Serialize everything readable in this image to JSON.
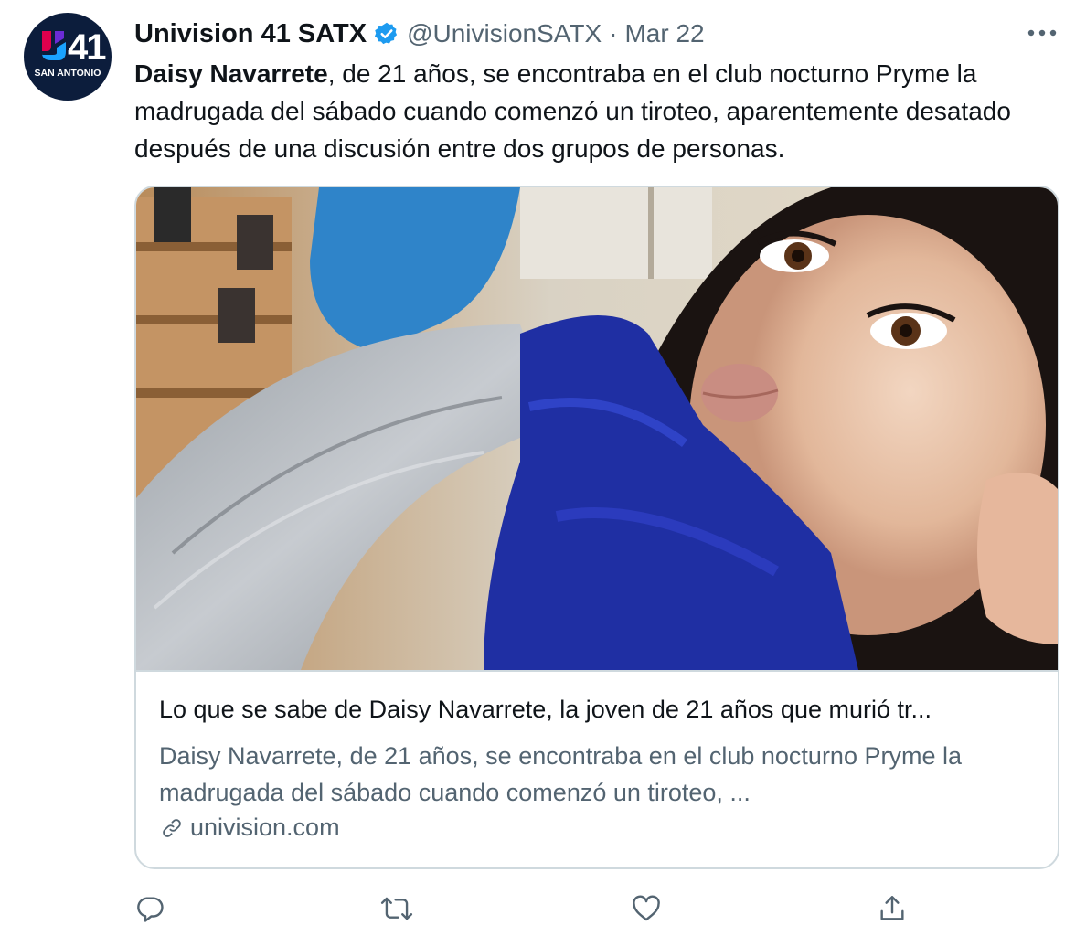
{
  "account": {
    "display_name": "Univision 41 SATX",
    "handle": "@UnivisionSATX",
    "separator": "·",
    "date": "Mar 22",
    "avatar_number": "41",
    "avatar_city": "SAN ANTONIO"
  },
  "tweet": {
    "name_highlight": "Daisy Navarrete",
    "text_rest": ", de 21 años, se encontraba en el club nocturno Pryme la madrugada del sábado cuando comenzó un tiroteo, aparentemente desatado después de una discusión entre dos grupos de personas."
  },
  "card": {
    "title": "Lo que se sabe de Daisy Navarrete, la joven de 21 años que murió tr...",
    "description": "Daisy Navarrete, de 21 años, se encontraba en el club nocturno Pryme la madrugada del sábado cuando comenzó un tiroteo, ...",
    "domain": "univision.com"
  },
  "icons": {
    "verified": "verified-badge-icon",
    "more": "more-options-icon",
    "reply": "reply-icon",
    "retweet": "retweet-icon",
    "like": "like-icon",
    "share": "share-icon",
    "link": "link-icon"
  },
  "colors": {
    "verified_blue": "#1d9bf0",
    "text_primary": "#0f1419",
    "text_secondary": "#536471",
    "border": "#cfd9de",
    "avatar_bg": "#0c1d3c"
  }
}
